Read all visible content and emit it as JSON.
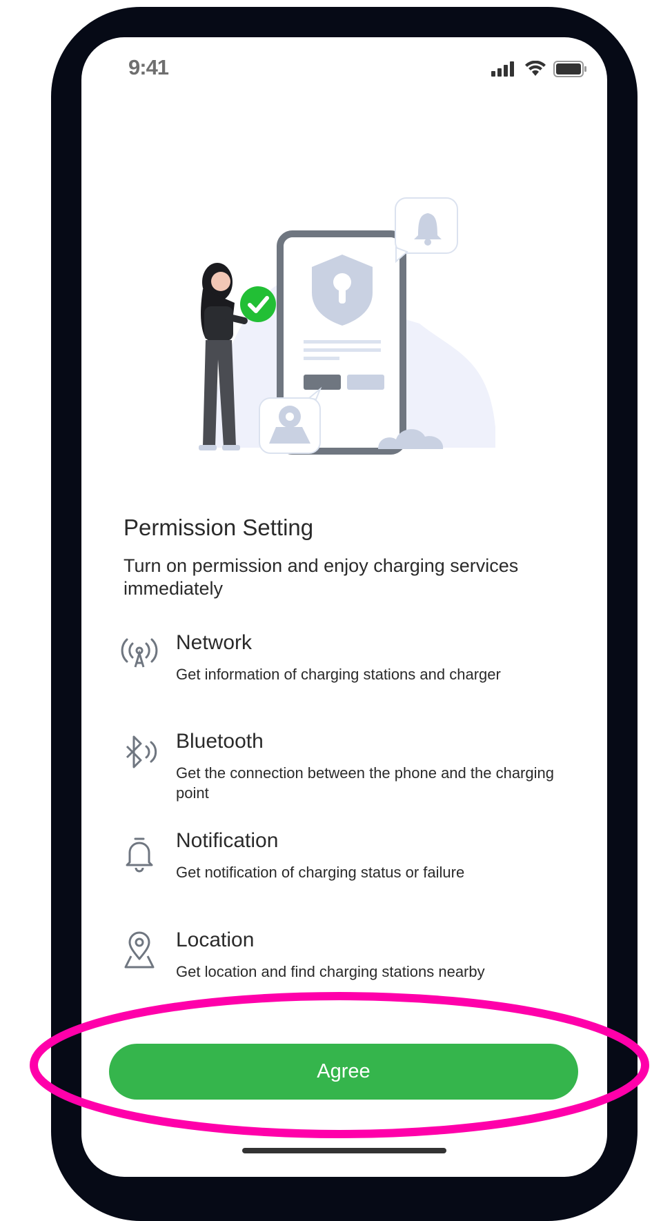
{
  "status_bar": {
    "time": "9:41",
    "icons": [
      "cellular-signal-icon",
      "wifi-icon",
      "battery-icon"
    ]
  },
  "illustration": {
    "description_icons": [
      "person-icon",
      "checkmark-badge-icon",
      "phone-icon",
      "shield-lock-icon",
      "bell-icon",
      "location-map-icon",
      "cloud-icon"
    ]
  },
  "permission": {
    "title": "Permission Setting",
    "subtitle": "Turn on permission and enjoy charging services immediately",
    "items": [
      {
        "icon": "network-antenna-icon",
        "title": "Network",
        "description": "Get information of charging stations and charger"
      },
      {
        "icon": "bluetooth-icon",
        "title": "Bluetooth",
        "description": "Get the connection between the phone and the charging point"
      },
      {
        "icon": "bell-icon",
        "title": "Notification",
        "description": "Get notification of charging status or failure"
      },
      {
        "icon": "location-pin-icon",
        "title": "Location",
        "description": "Get location and find charging stations nearby"
      }
    ]
  },
  "actions": {
    "agree_label": "Agree"
  },
  "colors": {
    "accent_green": "#35b54c",
    "highlight_magenta": "#ff00aa",
    "frame": "#060a16"
  }
}
